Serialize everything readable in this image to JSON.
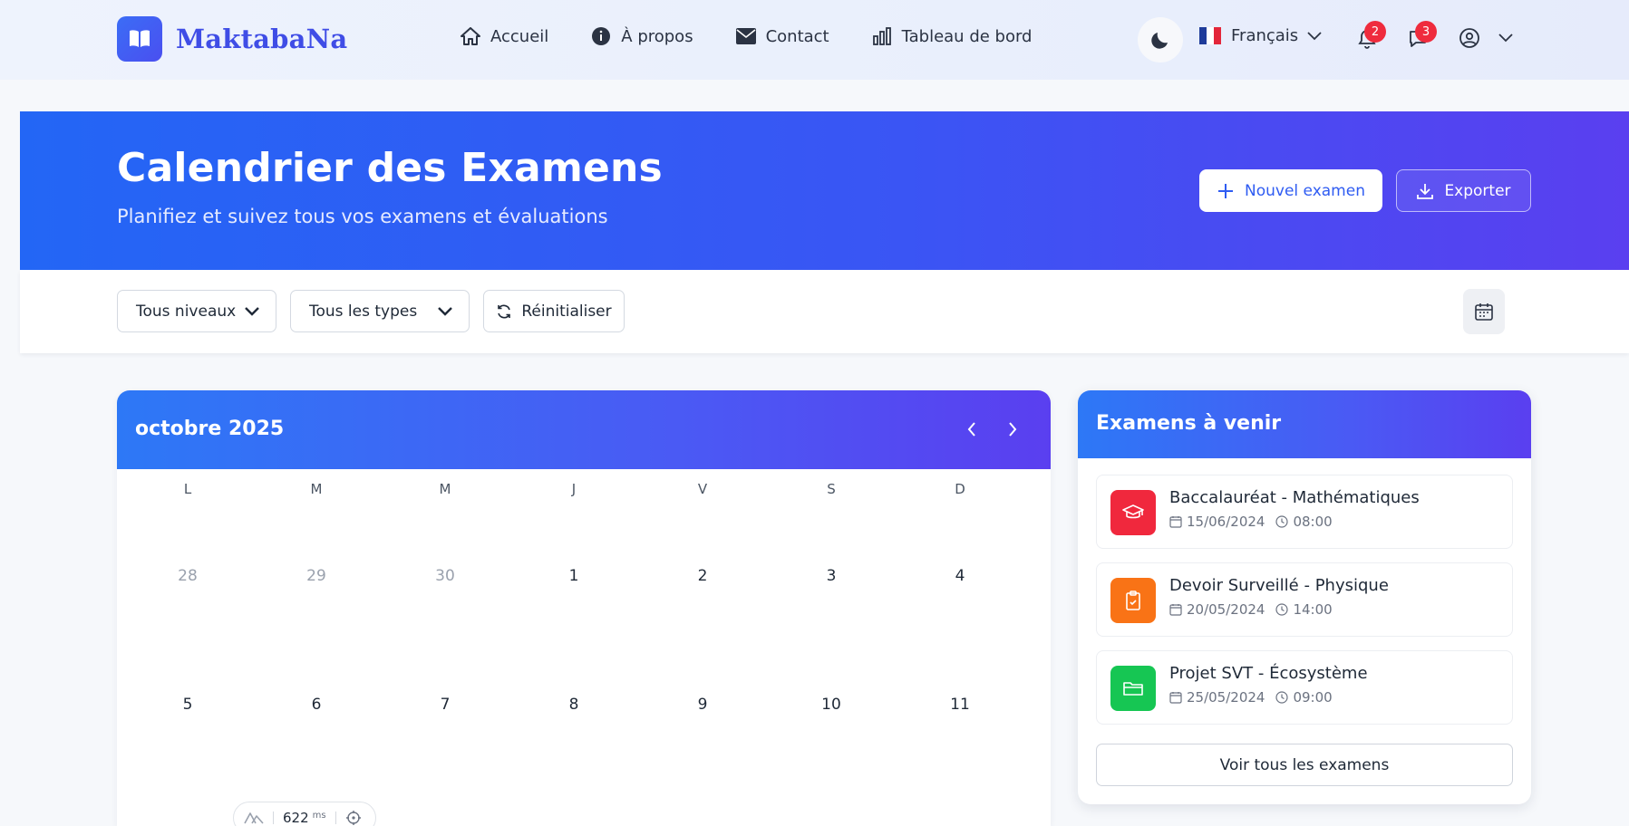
{
  "brand": {
    "name": "MaktabaNa"
  },
  "nav": {
    "links": [
      {
        "label": "Accueil",
        "icon": "home-icon"
      },
      {
        "label": "À propos",
        "icon": "info-icon"
      },
      {
        "label": "Contact",
        "icon": "mail-icon"
      },
      {
        "label": "Tableau de bord",
        "icon": "chart-icon"
      }
    ],
    "language": "Français",
    "notifications_count": "2",
    "messages_count": "3"
  },
  "hero": {
    "title": "Calendrier des Examens",
    "subtitle": "Planifiez et suivez tous vos examens et évaluations",
    "new_exam_label": "Nouvel examen",
    "export_label": "Exporter"
  },
  "filters": {
    "level": "Tous niveaux",
    "type": "Tous les types",
    "reset_label": "Réinitialiser"
  },
  "calendar": {
    "month": "octobre 2025",
    "weekdays": [
      "L",
      "M",
      "M",
      "J",
      "V",
      "S",
      "D"
    ],
    "weeks": [
      [
        "28",
        "29",
        "30",
        "1",
        "2",
        "3",
        "4"
      ],
      [
        "5",
        "6",
        "7",
        "8",
        "9",
        "10",
        "11"
      ]
    ],
    "muted_days_first_week": 3
  },
  "perf": {
    "value": "622",
    "unit": "ms"
  },
  "upcoming": {
    "title": "Examens à venir",
    "exams": [
      {
        "title": "Baccalauréat - Mathématiques",
        "date": "15/06/2024",
        "time": "08:00",
        "color": "#f0283d",
        "icon": "graduation-cap-icon"
      },
      {
        "title": "Devoir Surveillé - Physique",
        "date": "20/05/2024",
        "time": "14:00",
        "color": "#f97316",
        "icon": "clipboard-check-icon"
      },
      {
        "title": "Projet SVT - Écosystème",
        "date": "25/05/2024",
        "time": "09:00",
        "color": "#16c653",
        "icon": "folder-icon"
      }
    ],
    "see_all_label": "Voir tous les examens"
  },
  "colors": {
    "primary": "#2f5cf2",
    "brand": "#3f4de6",
    "badge": "#ef2b3d"
  }
}
